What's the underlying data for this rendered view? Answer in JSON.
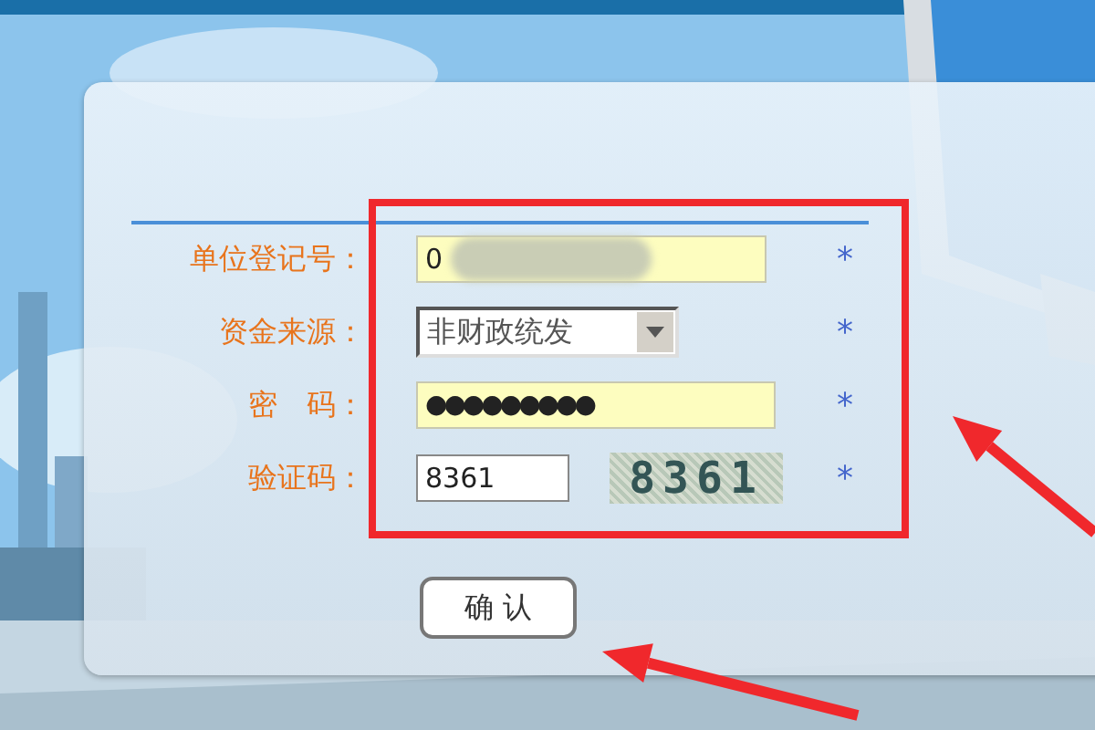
{
  "form": {
    "fields": [
      {
        "kind": "text",
        "label": "单位登记号：",
        "value": "0",
        "redacted": true,
        "highlighted": true,
        "required": "*"
      },
      {
        "kind": "select",
        "label": "资金来源：",
        "value": "非财政统发",
        "required": "*"
      },
      {
        "kind": "text",
        "label": "密　码：",
        "value": "●●●●●●●●●",
        "highlighted": true,
        "required": "*"
      },
      {
        "kind": "captcha",
        "label": "验证码：",
        "value": "8361",
        "code": "8361",
        "required": "*"
      }
    ],
    "submit": "确 认"
  },
  "annotations": {
    "box": true,
    "form_arrow": true,
    "button_arrow": true
  }
}
